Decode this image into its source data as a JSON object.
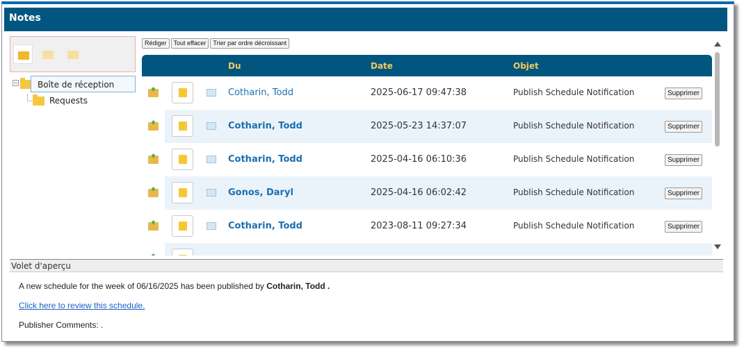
{
  "window": {
    "title": "Notes"
  },
  "folders": {
    "root": "Boîte de réception",
    "child": "Requests"
  },
  "actions": {
    "compose": "Rédiger",
    "clear_all": "Tout effacer",
    "sort_desc": "Trier par ordre décroissant"
  },
  "grid": {
    "columns": {
      "from": "Du",
      "date": "Date",
      "subject": "Objet"
    },
    "delete_label": "Supprimer",
    "rows": [
      {
        "from": "Cotharin, Todd",
        "date": "2025-06-17 09:47:38",
        "subject": "Publish Schedule Notification",
        "unread": false
      },
      {
        "from": "Cotharin, Todd",
        "date": "2025-05-23 14:37:07",
        "subject": "Publish Schedule Notification",
        "unread": true
      },
      {
        "from": "Cotharin, Todd",
        "date": "2025-04-16 06:10:36",
        "subject": "Publish Schedule Notification",
        "unread": true
      },
      {
        "from": "Gonos, Daryl",
        "date": "2025-04-16 06:02:42",
        "subject": "Publish Schedule Notification",
        "unread": true
      },
      {
        "from": "Cotharin, Todd",
        "date": "2023-08-11 09:27:34",
        "subject": "Publish Schedule Notification",
        "unread": true
      }
    ]
  },
  "preview": {
    "title": "Volet d'aperçu",
    "line1_prefix": "A new schedule for the week of 06/16/2025 has been published by ",
    "line1_name": "Cotharin, Todd .",
    "link": "Click here to review this schedule.",
    "comments": "Publisher Comments: ."
  },
  "colors": {
    "header_bg": "#00567f",
    "column_header_text": "#f4c95d",
    "link": "#1b6fb0",
    "row_shade": "#ebf3fa"
  }
}
